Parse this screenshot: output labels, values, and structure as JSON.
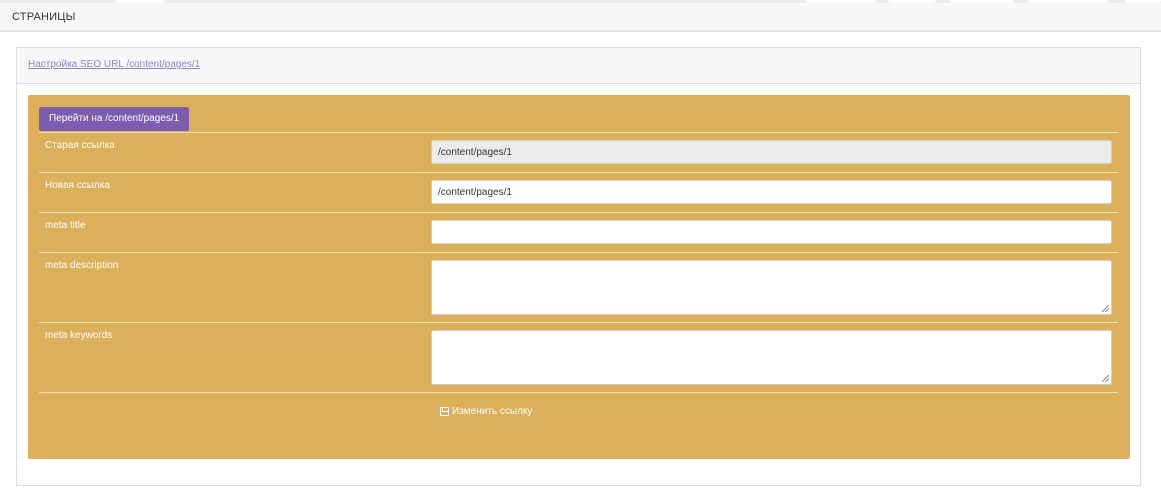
{
  "header": {
    "title": "СТРАНИЦЫ"
  },
  "panel": {
    "link_text": "Настройка SEO URL /content/pages/1"
  },
  "form": {
    "goto_button": "Перейти на /content/pages/1",
    "old_url": {
      "label": "Старая ссылка",
      "value": "/content/pages/1"
    },
    "new_url": {
      "label": "Новая ссылка",
      "value": "/content/pages/1"
    },
    "meta_title": {
      "label": "meta title",
      "value": ""
    },
    "meta_description": {
      "label": "meta description",
      "value": ""
    },
    "meta_keywords": {
      "label": "meta keywords",
      "value": ""
    },
    "save_label": "Изменить ссылку",
    "save_icon": "floppy-disk-icon"
  },
  "colors": {
    "form_background": "#dcb05b",
    "button_background": "#7d5daf",
    "link_color": "#8f83c4"
  }
}
